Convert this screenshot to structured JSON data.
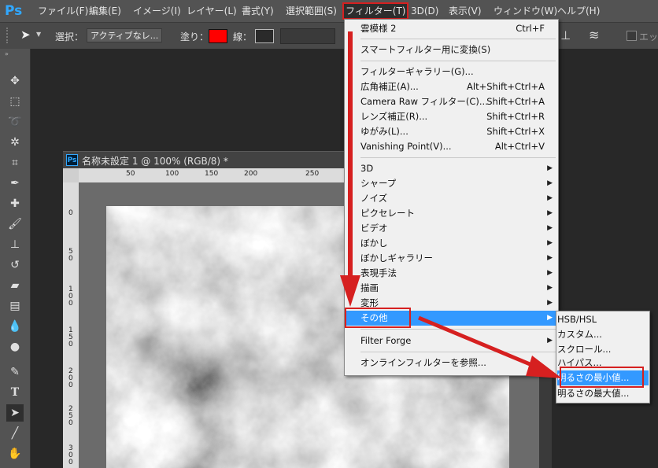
{
  "app": {
    "logo_text": "Ps"
  },
  "menubar": {
    "items": [
      "ファイル(F)",
      "編集(E)",
      "イメージ(I)",
      "レイヤー(L)",
      "書式(Y)",
      "選択範囲(S)",
      "フィルター(T)",
      "3D(D)",
      "表示(V)",
      "ウィンドウ(W)",
      "ヘルプ(H)"
    ],
    "active": "フィルター(T)"
  },
  "options": {
    "select_label": "選択：",
    "select_value": "アクティブなレ...",
    "fill_label": "塗り：",
    "stroke_label": "線：",
    "edge_label": "エッジ",
    "fill_color": "#ff0000"
  },
  "document": {
    "tab_title": "名称未設定 1 @ 100% (RGB/8) *",
    "ruler_h": [
      "50",
      "100",
      "150",
      "200",
      "250"
    ],
    "ruler_v": [
      "0",
      "5 0",
      "1 0 0",
      "1 5 0",
      "2 0 0",
      "2 5 0",
      "3 0 0"
    ]
  },
  "filter_menu": {
    "items": [
      {
        "label": "雲模様 2",
        "shortcut": "Ctrl+F"
      },
      {
        "label": "スマートフィルター用に変換(S)"
      },
      {
        "label": "フィルターギャラリー(G)..."
      },
      {
        "label": "広角補正(A)...",
        "shortcut": "Alt+Shift+Ctrl+A"
      },
      {
        "label": "Camera Raw フィルター(C)...",
        "shortcut": "Shift+Ctrl+A"
      },
      {
        "label": "レンズ補正(R)...",
        "shortcut": "Shift+Ctrl+R"
      },
      {
        "label": "ゆがみ(L)...",
        "shortcut": "Shift+Ctrl+X"
      },
      {
        "label": "Vanishing Point(V)...",
        "shortcut": "Alt+Ctrl+V"
      },
      {
        "label": "3D"
      },
      {
        "label": "シャープ"
      },
      {
        "label": "ノイズ"
      },
      {
        "label": "ピクセレート"
      },
      {
        "label": "ビデオ"
      },
      {
        "label": "ぼかし"
      },
      {
        "label": "ぼかしギャラリー"
      },
      {
        "label": "表現手法"
      },
      {
        "label": "描画"
      },
      {
        "label": "変形"
      },
      {
        "label": "その他"
      },
      {
        "label": "Filter Forge"
      },
      {
        "label": "オンラインフィルターを参照..."
      }
    ]
  },
  "other_submenu": {
    "items": [
      "HSB/HSL",
      "カスタム...",
      "スクロール...",
      "ハイパス...",
      "明るさの最小値...",
      "明るさの最大値..."
    ],
    "highlighted": "明るさの最小値..."
  },
  "colors": {
    "highlight": "#3399ff",
    "annotation_red": "#d62020"
  }
}
